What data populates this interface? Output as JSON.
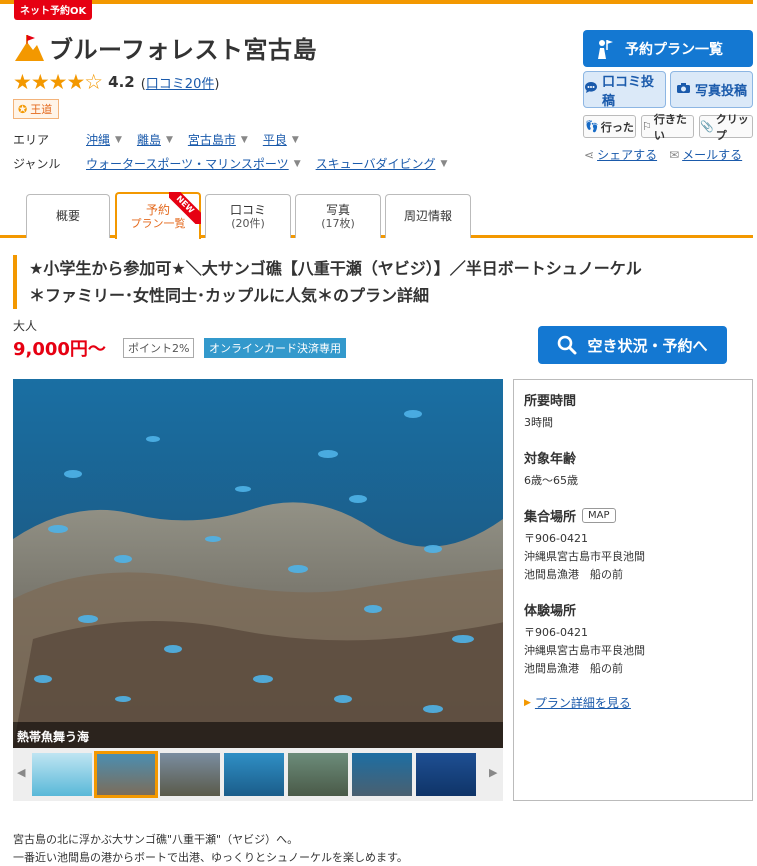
{
  "badge": "ネット予約OK",
  "title": "ブルーフォレスト宮古島",
  "rating": {
    "stars": "★★★★☆",
    "score": "4.2",
    "paren_open": "(",
    "reviews": "口コミ20件",
    "paren_close": ")"
  },
  "tag": "王道",
  "meta": {
    "area_label": "エリア",
    "areas": [
      "沖縄",
      "離島",
      "宮古島市",
      "平良"
    ],
    "genre_label": "ジャンル",
    "genres": [
      "ウォータースポーツ・マリンスポーツ",
      "スキューバダイビング"
    ]
  },
  "actions": {
    "plan_list": "予約プラン一覧",
    "review_post": "口コミ投稿",
    "photo_post": "写真投稿",
    "went": "行った",
    "want": "行きたい",
    "clip": "クリップ",
    "share": "シェアする",
    "mail": "メールする"
  },
  "tabs": [
    {
      "label": "概要",
      "sub": ""
    },
    {
      "label": "予約",
      "sub": "プラン一覧",
      "new": "NEW"
    },
    {
      "label": "口コミ",
      "sub": "(20件)"
    },
    {
      "label": "写真",
      "sub": "(17枚)"
    },
    {
      "label": "周辺情報",
      "sub": ""
    }
  ],
  "plan": {
    "title_line1": "★小学生から参加可★＼大サンゴ礁【八重干瀬（ヤビジ）】／半日ボートシュノーケル",
    "title_line2": "＊ファミリー･女性同士･カップルに人気＊のプラン詳細",
    "price_label": "大人",
    "price": "9,000円〜",
    "points": "ポイント2%",
    "card": "オンラインカード決済専用",
    "availability": "空き状況・予約へ"
  },
  "photo_caption": "熱帯魚舞う海",
  "info": {
    "duration_label": "所要時間",
    "duration": "3時間",
    "age_label": "対象年齢",
    "age": "6歳〜65歳",
    "meeting_label": "集合場所",
    "map": "MAP",
    "meeting_zip": "〒906-0421",
    "meeting_addr": "沖縄県宮古島市平良池間",
    "meeting_place": "池間島漁港　船の前",
    "venue_label": "体験場所",
    "venue_zip": "〒906-0421",
    "venue_addr": "沖縄県宮古島市平良池間",
    "venue_place": "池間島漁港　船の前",
    "detail_link": "プラン詳細を見る"
  },
  "description": {
    "line1": "宮古島の北に浮かぶ大サンゴ礁\"八重干瀬\"（ヤビジ）へ。",
    "line2": "一番近い池間島の港からボートで出港、ゆっくりとシュノーケルを楽しめます。"
  },
  "colors": {
    "accent": "#f39800",
    "primary": "#1478d2",
    "price": "#e60012",
    "link": "#1a5aab"
  }
}
